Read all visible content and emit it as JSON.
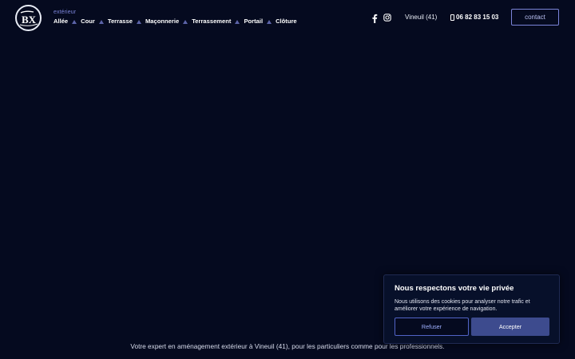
{
  "header": {
    "logo_icon": "bx-monogram-logo",
    "nav_kicker": "extérieur",
    "nav_items": [
      {
        "label": "Allée"
      },
      {
        "label": "Cour"
      },
      {
        "label": "Terrasse"
      },
      {
        "label": "Maçonnerie"
      },
      {
        "label": "Terrassement"
      },
      {
        "label": "Portail"
      },
      {
        "label": "Clôture"
      }
    ],
    "social": {
      "facebook_icon": "facebook-icon",
      "instagram_icon": "instagram-icon"
    },
    "location": "Vineuil (41)",
    "phone": "06 82 83 15 03",
    "contact_label": "contact"
  },
  "hero": {
    "tagline": "Votre expert en aménagement extérieur à Vineuil (41), pour les particuliers comme pour les professionnels."
  },
  "cookie_banner": {
    "title": "Nous respectons votre vie privée",
    "text": "Nous utilisons des cookies pour analyser notre trafic et améliorer votre expérience de navigation.",
    "refuse_label": "Refuser",
    "accept_label": "Accepter"
  },
  "colors": {
    "background": "#050a1f",
    "accent": "#7b84d9",
    "accept_button": "#3d4b8e",
    "refuse_border": "#5163c6"
  }
}
